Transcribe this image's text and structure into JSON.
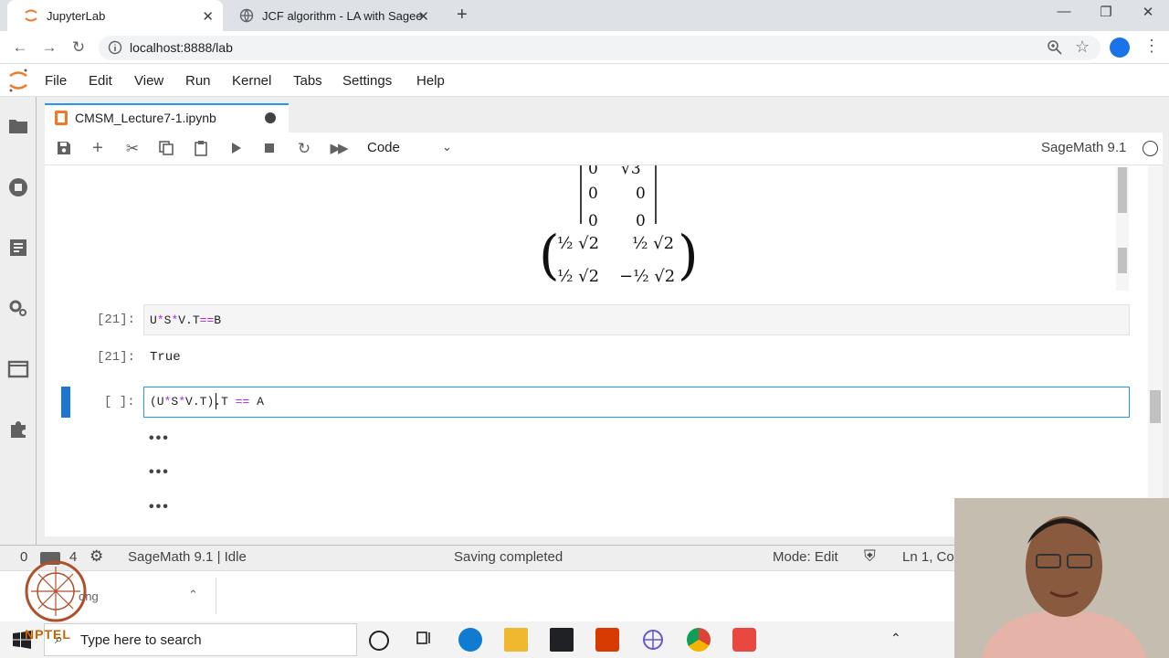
{
  "browser": {
    "tabs": [
      {
        "label": "JupyterLab",
        "icon": "jupyter-icon",
        "active": true
      },
      {
        "label": "JCF algorithm - LA with Sagee",
        "icon": "globe-icon",
        "active": false
      }
    ],
    "new_tab": "+",
    "url": "localhost:8888/lab"
  },
  "menu": [
    "File",
    "Edit",
    "View",
    "Run",
    "Kernel",
    "Tabs",
    "Settings",
    "Help"
  ],
  "notebook": {
    "tab_label": "CMSM_Lecture7-1.ipynb",
    "cell_type": "Code",
    "kernel": "SageMath 9.1"
  },
  "output_matrix_top": {
    "rows": [
      [
        "0",
        "√3"
      ],
      [
        "0",
        "0"
      ],
      [
        "0",
        "0"
      ]
    ]
  },
  "output_matrix_bottom": {
    "rows": [
      [
        "½ √2",
        "½ √2"
      ],
      [
        "½ √2",
        "−½ √2"
      ]
    ]
  },
  "cells": [
    {
      "prompt": "[21]:",
      "code_parts": [
        "U",
        "*",
        "S",
        "*",
        "V.T",
        "==",
        "B"
      ],
      "output_prompt": "[21]:",
      "output": "True"
    },
    {
      "prompt": "[ ]:",
      "code_parts": [
        "(U",
        "*",
        "S",
        "*",
        "V.T).T ",
        "==",
        " A"
      ]
    }
  ],
  "ellipsis": "•••",
  "status": {
    "left_num": "0",
    "left_num2": "4",
    "kernel": "SageMath 9.1 | Idle",
    "center": "Saving completed",
    "mode": "Mode: Edit",
    "position": "Ln 1, Co"
  },
  "download_bar_text": "ong",
  "taskbar": {
    "search_placeholder": "Type here to search",
    "logo_text": "NPTEL"
  },
  "colors": {
    "accent": "#2196f3",
    "active_cell_bar": "#1976d2",
    "operator": "#aa22ff",
    "jupyter_orange": "#f37726"
  }
}
